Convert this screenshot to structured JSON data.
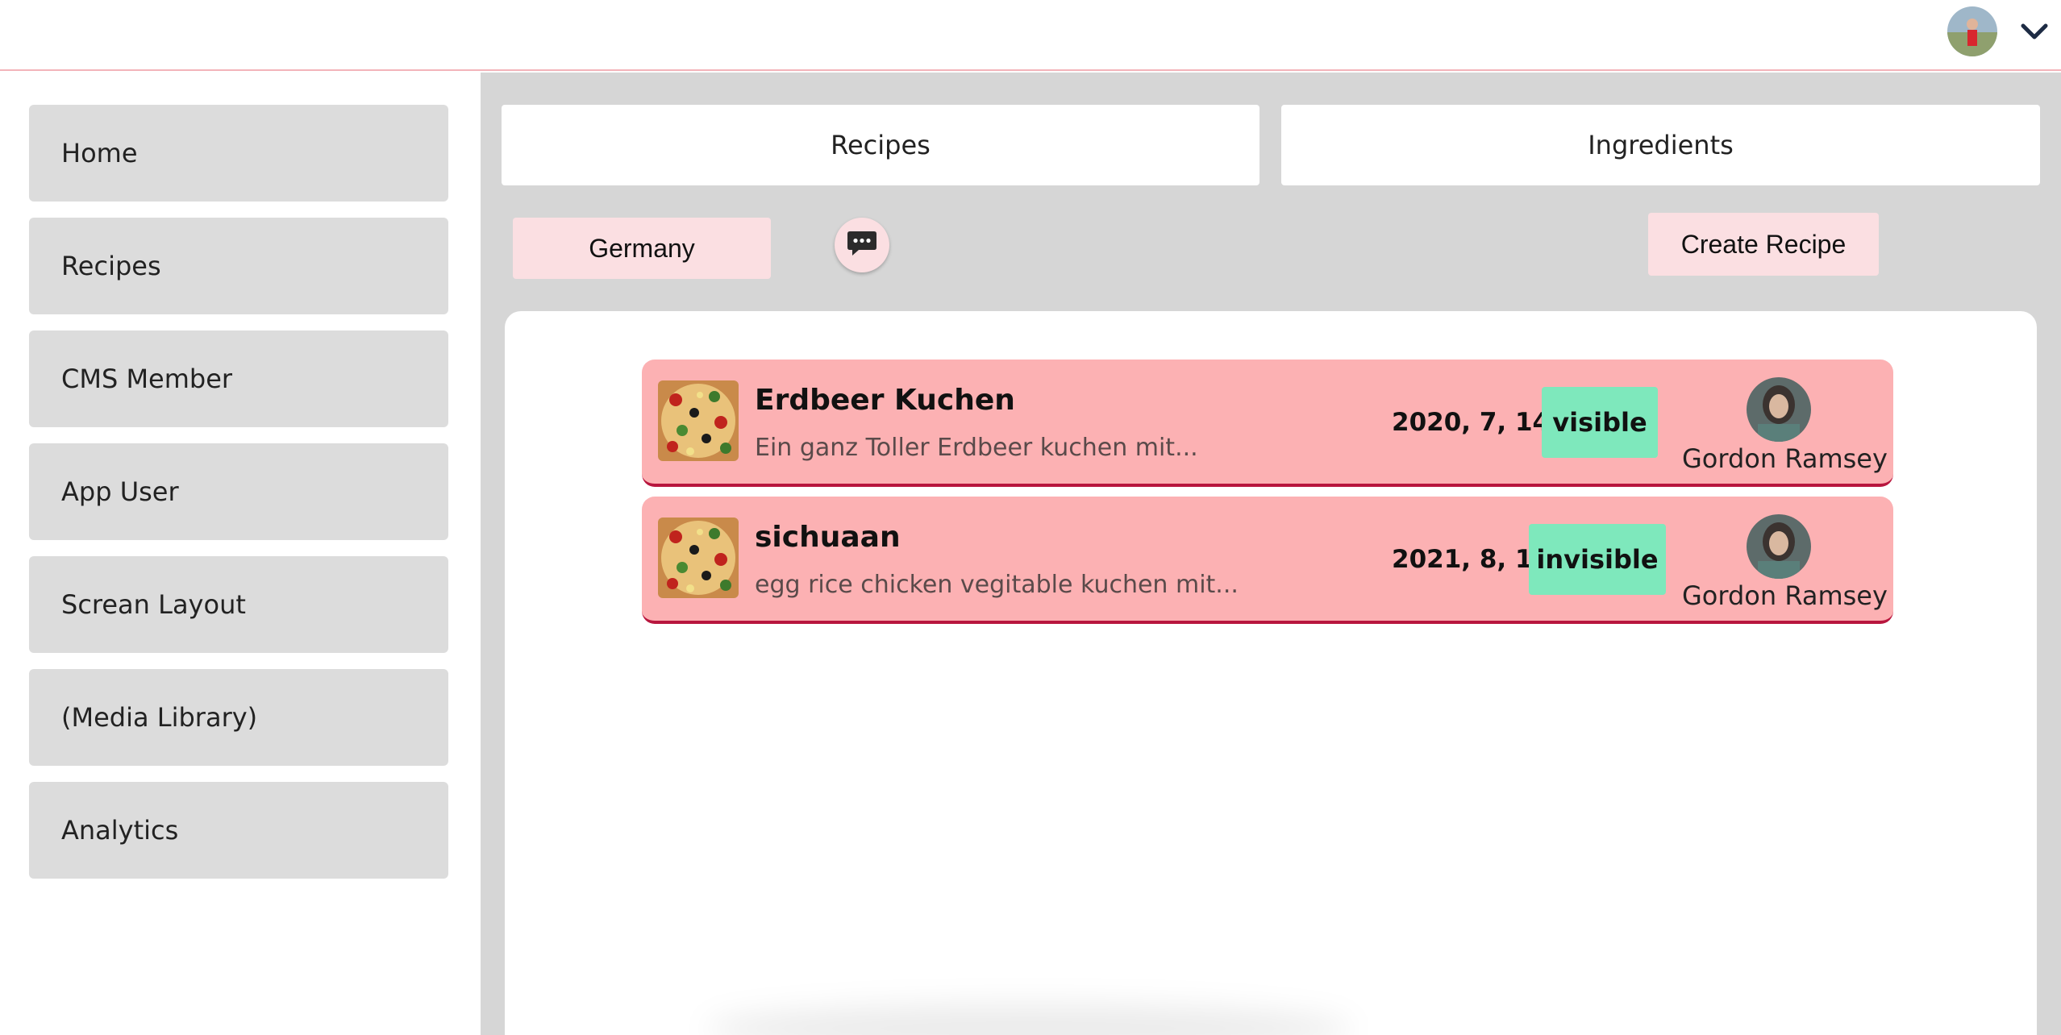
{
  "header": {
    "avatar_icon": "user-avatar-icon",
    "menu_icon": "chevron-down-icon"
  },
  "sidebar": {
    "items": [
      {
        "label": "Home"
      },
      {
        "label": "Recipes"
      },
      {
        "label": "CMS Member"
      },
      {
        "label": "App User"
      },
      {
        "label": "Screan Layout"
      },
      {
        "label": "(Media Library)"
      },
      {
        "label": "Analytics"
      }
    ]
  },
  "tabs": {
    "recipes": "Recipes",
    "ingredients": "Ingredients"
  },
  "toolbar": {
    "country": "Germany",
    "chat_icon": "chat-bubble-icon",
    "create_label": "Create Recipe"
  },
  "recipes": [
    {
      "title": "Erdbeer Kuchen",
      "description": "Ein ganz Toller Erdbeer kuchen mit...",
      "date": "2020, 7, 14",
      "status": "visible",
      "author": "Gordon Ramsey"
    },
    {
      "title": "sichuaan",
      "description": "egg rice chicken vegitable kuchen mit...",
      "date": "2021, 8, 15",
      "status": "invisible",
      "author": "Gordon Ramsey"
    }
  ],
  "colors": {
    "row_background": "#fcb1b3",
    "row_border": "#b8163e",
    "status_badge": "#7ee8bc",
    "chip_background": "#fbdfe2"
  }
}
